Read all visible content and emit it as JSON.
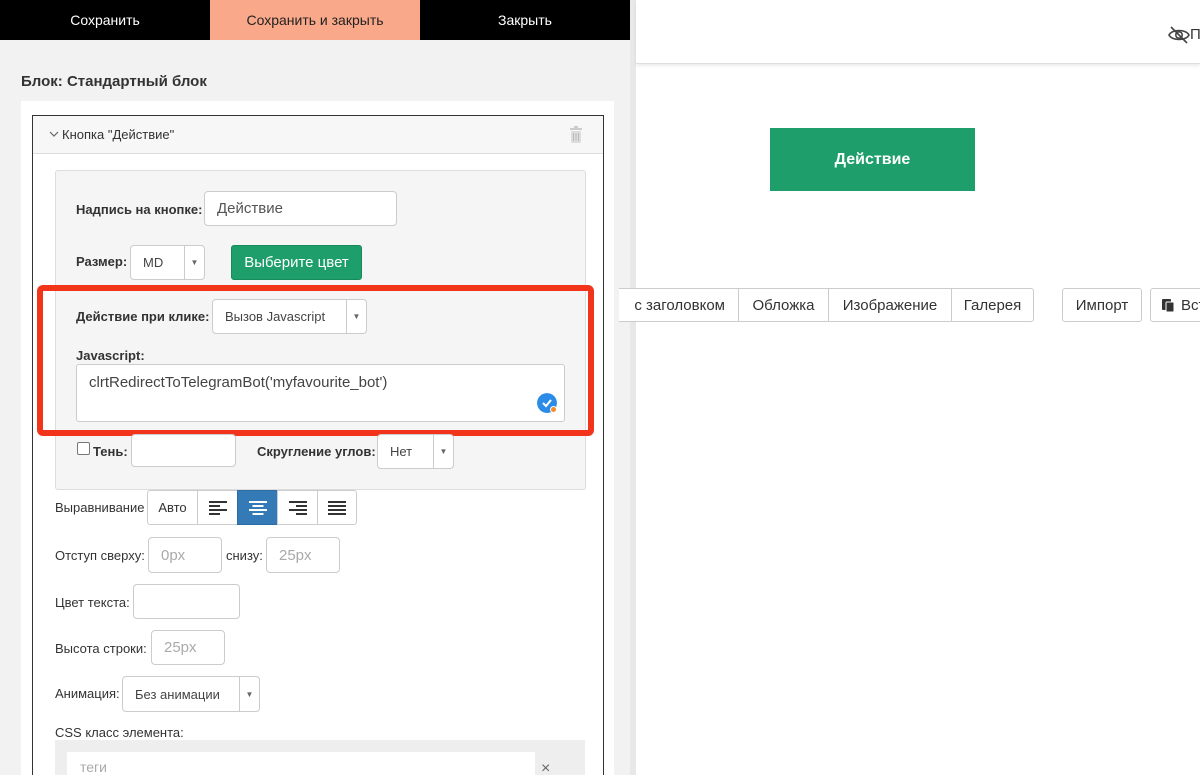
{
  "toolbar": {
    "save_label": "Сохранить",
    "save_close_label": "Сохранить и закрыть",
    "close_label": "Закрыть"
  },
  "editor": {
    "block_title": "Блок: Стандартный блок",
    "card_title": "Кнопка \"Действие\"",
    "caption_label": "Надпись на кнопке:",
    "caption_value": "Действие",
    "size_label": "Размер:",
    "size_value": "MD",
    "choose_color_label": "Выберите цвет",
    "click_action_label": "Действие при клике:",
    "click_action_value": "Вызов Javascript",
    "javascript_label": "Javascript:",
    "javascript_value": "clrtRedirectToTelegramBot('myfavourite_bot')",
    "shadow_label": "Тень:",
    "corner_label": "Скругление углов:",
    "corner_value": "Нет",
    "align_label": "Выравнивание",
    "align_auto": "Авто",
    "padding_top_label": "Отступ сверху:",
    "padding_top_placeholder": "0px",
    "padding_bottom_label": "снизу:",
    "padding_bottom_placeholder": "25px",
    "text_color_label": "Цвет текста:",
    "line_height_label": "Высота строки:",
    "line_height_placeholder": "25px",
    "animation_label": "Анимация:",
    "animation_value": "Без анимации",
    "css_class_label": "CSS класс элемента:",
    "tags_placeholder": "теги",
    "tags_clear": "×"
  },
  "preview": {
    "eye_text": "П",
    "action_button_label": "Действие",
    "action_button_color": "#1e9e6a",
    "layouts": [
      "с заголовком",
      "Обложка",
      "Изображение",
      "Галерея"
    ],
    "import_label": "Импорт",
    "insert_label": "Вст"
  },
  "colors": {
    "accent_green": "#1e9e6a",
    "save_close_bg": "#f9a88a",
    "highlight_red": "#f2341a",
    "active_blue": "#337ab7"
  }
}
